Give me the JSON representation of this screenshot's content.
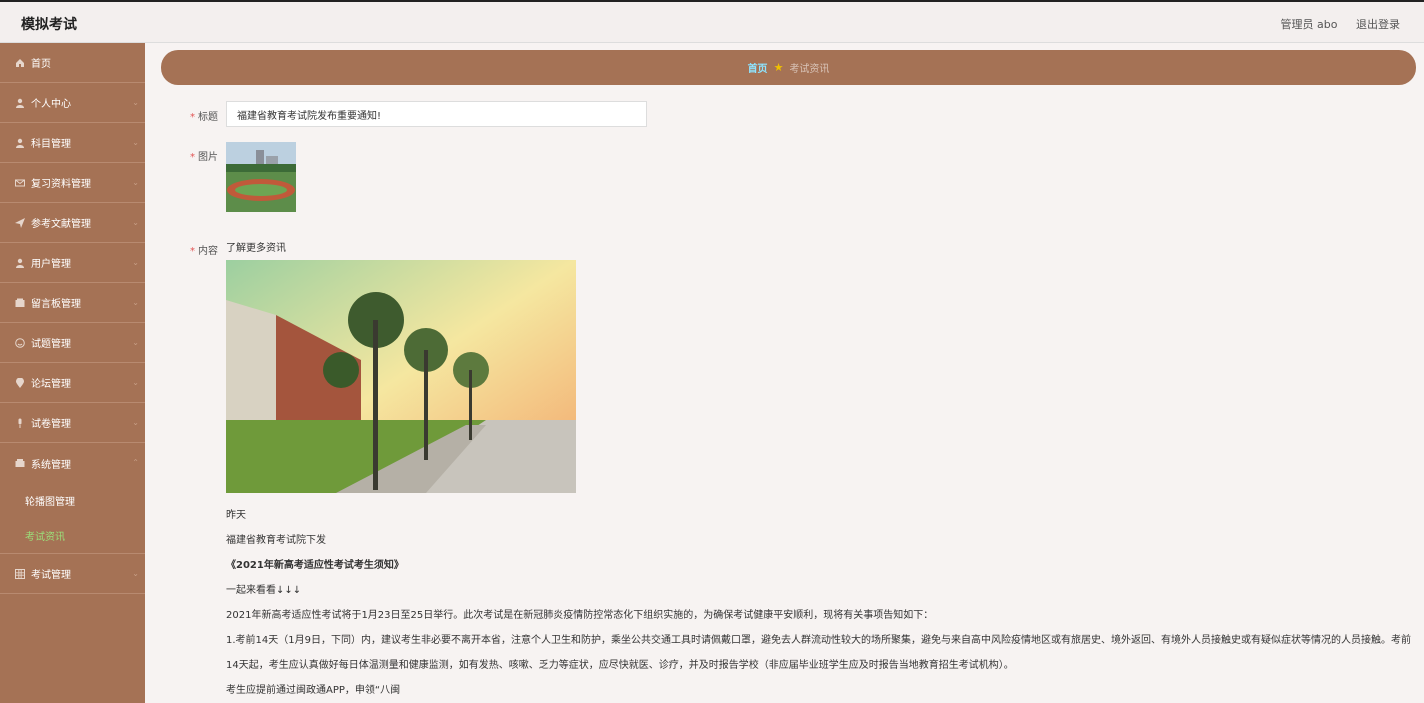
{
  "header": {
    "app_title": "模拟考试",
    "admin_label": "管理员 abo",
    "logout_label": "退出登录"
  },
  "sidebar": {
    "items": [
      {
        "label": "首页",
        "icon": "home-icon"
      },
      {
        "label": "个人中心",
        "icon": "user-icon"
      },
      {
        "label": "科目管理",
        "icon": "user-icon"
      },
      {
        "label": "复习资料管理",
        "icon": "mail-icon"
      },
      {
        "label": "参考文献管理",
        "icon": "send-icon"
      },
      {
        "label": "用户管理",
        "icon": "user-icon"
      },
      {
        "label": "留言板管理",
        "icon": "message-icon"
      },
      {
        "label": "试题管理",
        "icon": "smile-icon"
      },
      {
        "label": "论坛管理",
        "icon": "location-icon"
      },
      {
        "label": "试卷管理",
        "icon": "mic-icon"
      },
      {
        "label": "系统管理",
        "icon": "box-icon"
      }
    ],
    "sub_items": [
      {
        "label": "轮播图管理"
      },
      {
        "label": "考试资讯"
      }
    ],
    "last_item": {
      "label": "考试管理",
      "icon": "grid-icon"
    }
  },
  "breadcrumb": {
    "home": "首页",
    "current": "考试资讯"
  },
  "form": {
    "title_label": "标题",
    "title_value": "福建省教育考试院发布重要通知!",
    "image_label": "图片",
    "content_label": "内容"
  },
  "content": {
    "intro": "了解更多资讯",
    "p1": "昨天",
    "p2": "福建省教育考试院下发",
    "p3": "《2021年新高考适应性考试考生须知》",
    "p4": "一起来看看↓↓↓",
    "p5": "2021年新高考适应性考试将于1月23日至25日举行。此次考试是在新冠肺炎疫情防控常态化下组织实施的，为确保考试健康平安顺利，现将有关事项告知如下：",
    "p6": "1.考前14天（1月9日，下同）内，建议考生非必要不离开本省，注意个人卫生和防护，乘坐公共交通工具时请佩戴口罩，避免去人群流动性较大的场所聚集，避免与来自高中风险疫情地区或有旅居史、境外返回、有境外人员接触史或有疑似症状等情况的人员接触。考前14天起，考生应认真做好每日体温测量和健康监测，如有发热、咳嗽、乏力等症状，应尽快就医、诊疗，并及时报告学校（非应届毕业班学生应及时报告当地教育招生考试机构）。",
    "p7": "考生应提前通过闽政通APP，申领“八闽"
  },
  "colors": {
    "sidebar_bg": "#a57255",
    "active_sub": "#9be07a",
    "crumb_home": "#8ee4ff",
    "required": "#e25555"
  }
}
